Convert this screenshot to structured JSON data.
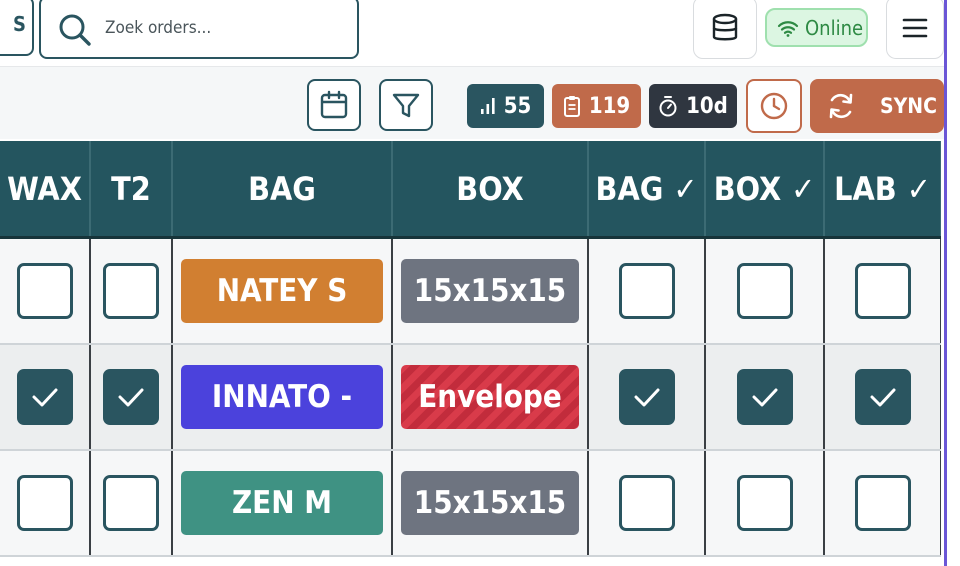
{
  "header": {
    "partial_tab_label": "S",
    "search": {
      "placeholder": "Zoek orders...",
      "value": ""
    },
    "status_label": "Online"
  },
  "toolbar": {
    "chips": [
      {
        "icon": "bar-chart-icon",
        "value": "55",
        "color": "#2a5560"
      },
      {
        "icon": "clipboard-icon",
        "value": "119",
        "color": "#c06a4a"
      },
      {
        "icon": "stopwatch-icon",
        "value": "10d",
        "color": "#2f3640"
      }
    ],
    "sync_label": "SYNC"
  },
  "table": {
    "columns": [
      "WAX",
      "T2",
      "BAG",
      "BOX",
      "BAG ✓",
      "BOX ✓",
      "LAB ✓"
    ],
    "rows": [
      {
        "wax": false,
        "t2": false,
        "bag": "NATEY S",
        "bag_color": "#d17f31",
        "box": "15x15x15",
        "bag_check": false,
        "box_check": false,
        "lab_check": false
      },
      {
        "wax": true,
        "t2": true,
        "bag": "INNATO -",
        "bag_color": "#4b42dc",
        "box": "Envelope",
        "bag_check": true,
        "box_check": true,
        "lab_check": true
      },
      {
        "wax": false,
        "t2": false,
        "bag": "ZEN M",
        "bag_color": "#3f9283",
        "box": "15x15x15",
        "bag_check": false,
        "box_check": false,
        "lab_check": false
      }
    ]
  },
  "colors": {
    "primary": "#2a5560",
    "accent": "#c06a4a",
    "online": "#2e8a44",
    "envelope": "#d93b4a"
  }
}
